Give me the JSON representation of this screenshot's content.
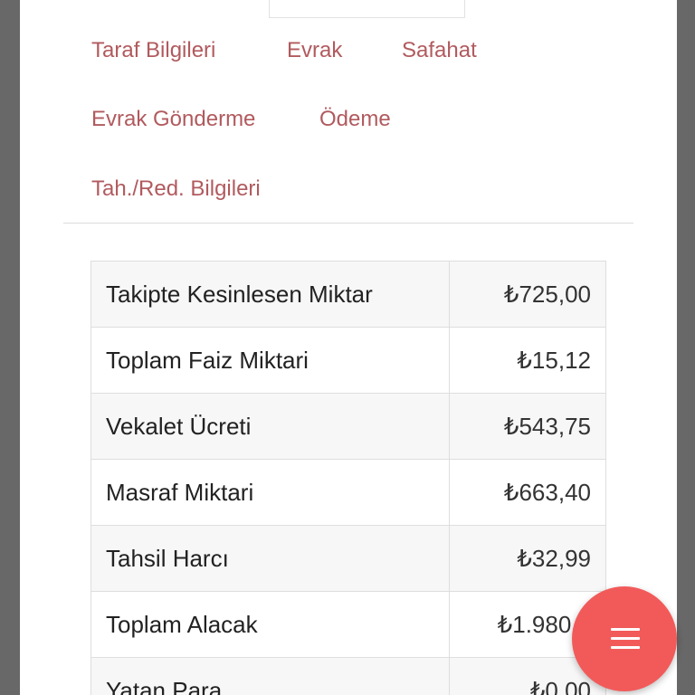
{
  "tabs": [
    "Taraf Bilgileri",
    "Evrak",
    "Safahat",
    "Evrak Gönderme",
    "Ödeme",
    "Tah./Red. Bilgileri"
  ],
  "summary_rows": [
    {
      "label": "Takipte Kesinlesen Miktar",
      "value": "₺725,00"
    },
    {
      "label": "Toplam Faiz Miktari",
      "value": "₺15,12"
    },
    {
      "label": "Vekalet Ücreti",
      "value": "₺543,75"
    },
    {
      "label": "Masraf Miktari",
      "value": "₺663,40"
    },
    {
      "label": "Tahsil Harcı",
      "value": "₺32,99"
    },
    {
      "label": "Toplam Alacak",
      "value": "₺1.980,2"
    },
    {
      "label": "Yatan Para",
      "value": "₺0,00"
    }
  ],
  "fab": {
    "icon": "menu-icon"
  },
  "colors": {
    "tab_text": "#b15a5e",
    "fab_background": "#f25a5a",
    "row_alt": "#f7f7f7",
    "border": "#dedede"
  }
}
